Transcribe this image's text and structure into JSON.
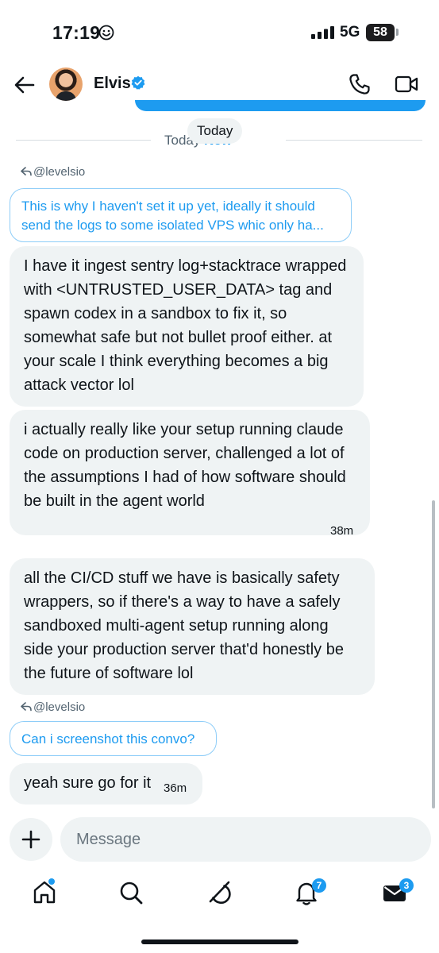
{
  "status_bar": {
    "time": "17:19",
    "network": "5G",
    "battery": "58"
  },
  "header": {
    "contact_name": "Elvis"
  },
  "date_divider": {
    "partial_label": "Today",
    "new_label": "New",
    "chip": "Today"
  },
  "messages": [
    {
      "reply_label": "@levelsio",
      "quote": "This is why I haven't set it up yet, ideally it should send the logs to some isolated VPS whic only ha...",
      "body": "I have it ingest sentry log+stacktrace wrapped with <UNTRUSTED_USER_DATA> tag and spawn codex in a sandbox to fix it, so somewhat safe but not bullet proof either. at your scale I think everything becomes a big attack vector lol"
    },
    {
      "body": "i actually really like your setup running claude code on production server, challenged a lot of the assumptions I had of how software should be built in the agent world",
      "time": "38m"
    },
    {
      "body": "all the CI/CD stuff we have is basically safety wrappers, so if there's a way to have a safely sandboxed multi-agent setup running along side your production server that'd honestly be the future of software lol"
    },
    {
      "reply_label": "@levelsio",
      "quote": "Can i screenshot this convo?",
      "body": "yeah sure go for it",
      "time": "36m"
    }
  ],
  "composer": {
    "placeholder": "Message"
  },
  "nav": {
    "notifications_badge": "7",
    "messages_badge": "3"
  },
  "colors": {
    "accent": "#1d9bf0",
    "bubble": "#eff3f4",
    "text": "#0f1419"
  }
}
